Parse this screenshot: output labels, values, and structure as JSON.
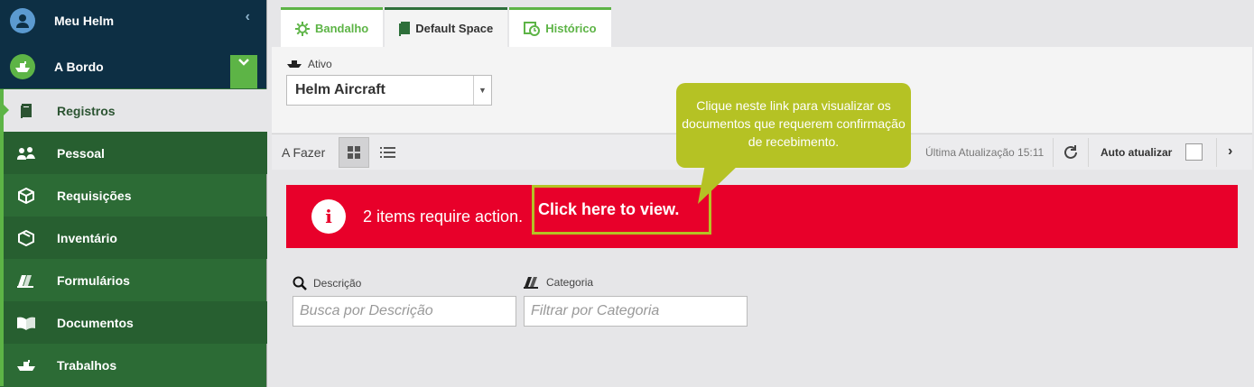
{
  "sidebar": {
    "user_label": "Meu Helm",
    "vessel_label": "A Bordo",
    "items": [
      {
        "label": "Registros",
        "icon": "book-icon",
        "active": true
      },
      {
        "label": "Pessoal",
        "icon": "people-icon"
      },
      {
        "label": "Requisições",
        "icon": "box-icon"
      },
      {
        "label": "Inventário",
        "icon": "package-icon"
      },
      {
        "label": "Formulários",
        "icon": "forms-icon"
      },
      {
        "label": "Documentos",
        "icon": "open-book-icon"
      },
      {
        "label": "Trabalhos",
        "icon": "ship-icon"
      }
    ]
  },
  "tabs": [
    {
      "label": "Bandalho",
      "icon": "gear-icon"
    },
    {
      "label": "Default Space",
      "icon": "book-icon",
      "active": true
    },
    {
      "label": "Histórico",
      "icon": "history-icon"
    }
  ],
  "asset": {
    "label": "Ativo",
    "value": "Helm Aircraft"
  },
  "toolbar": {
    "todo_label": "A Fazer",
    "last_update": "Última Atualização 15:11",
    "auto_refresh_label": "Auto atualizar"
  },
  "alert": {
    "message": "2 items require action.",
    "link": "Click here to view."
  },
  "filters": {
    "description_label": "Descrição",
    "description_placeholder": "Busca por Descrição",
    "category_label": "Categoria",
    "category_placeholder": "Filtrar por Categoria"
  },
  "callout": {
    "text": "Clique neste link para visualizar os documentos que requerem confirmação de recebimento."
  },
  "colors": {
    "brand_green": "#5db446",
    "sidebar_dark": "#0d2f44",
    "sidebar_green": "#2c6b35",
    "alert_red": "#e8002a",
    "callout": "#b5c224"
  }
}
